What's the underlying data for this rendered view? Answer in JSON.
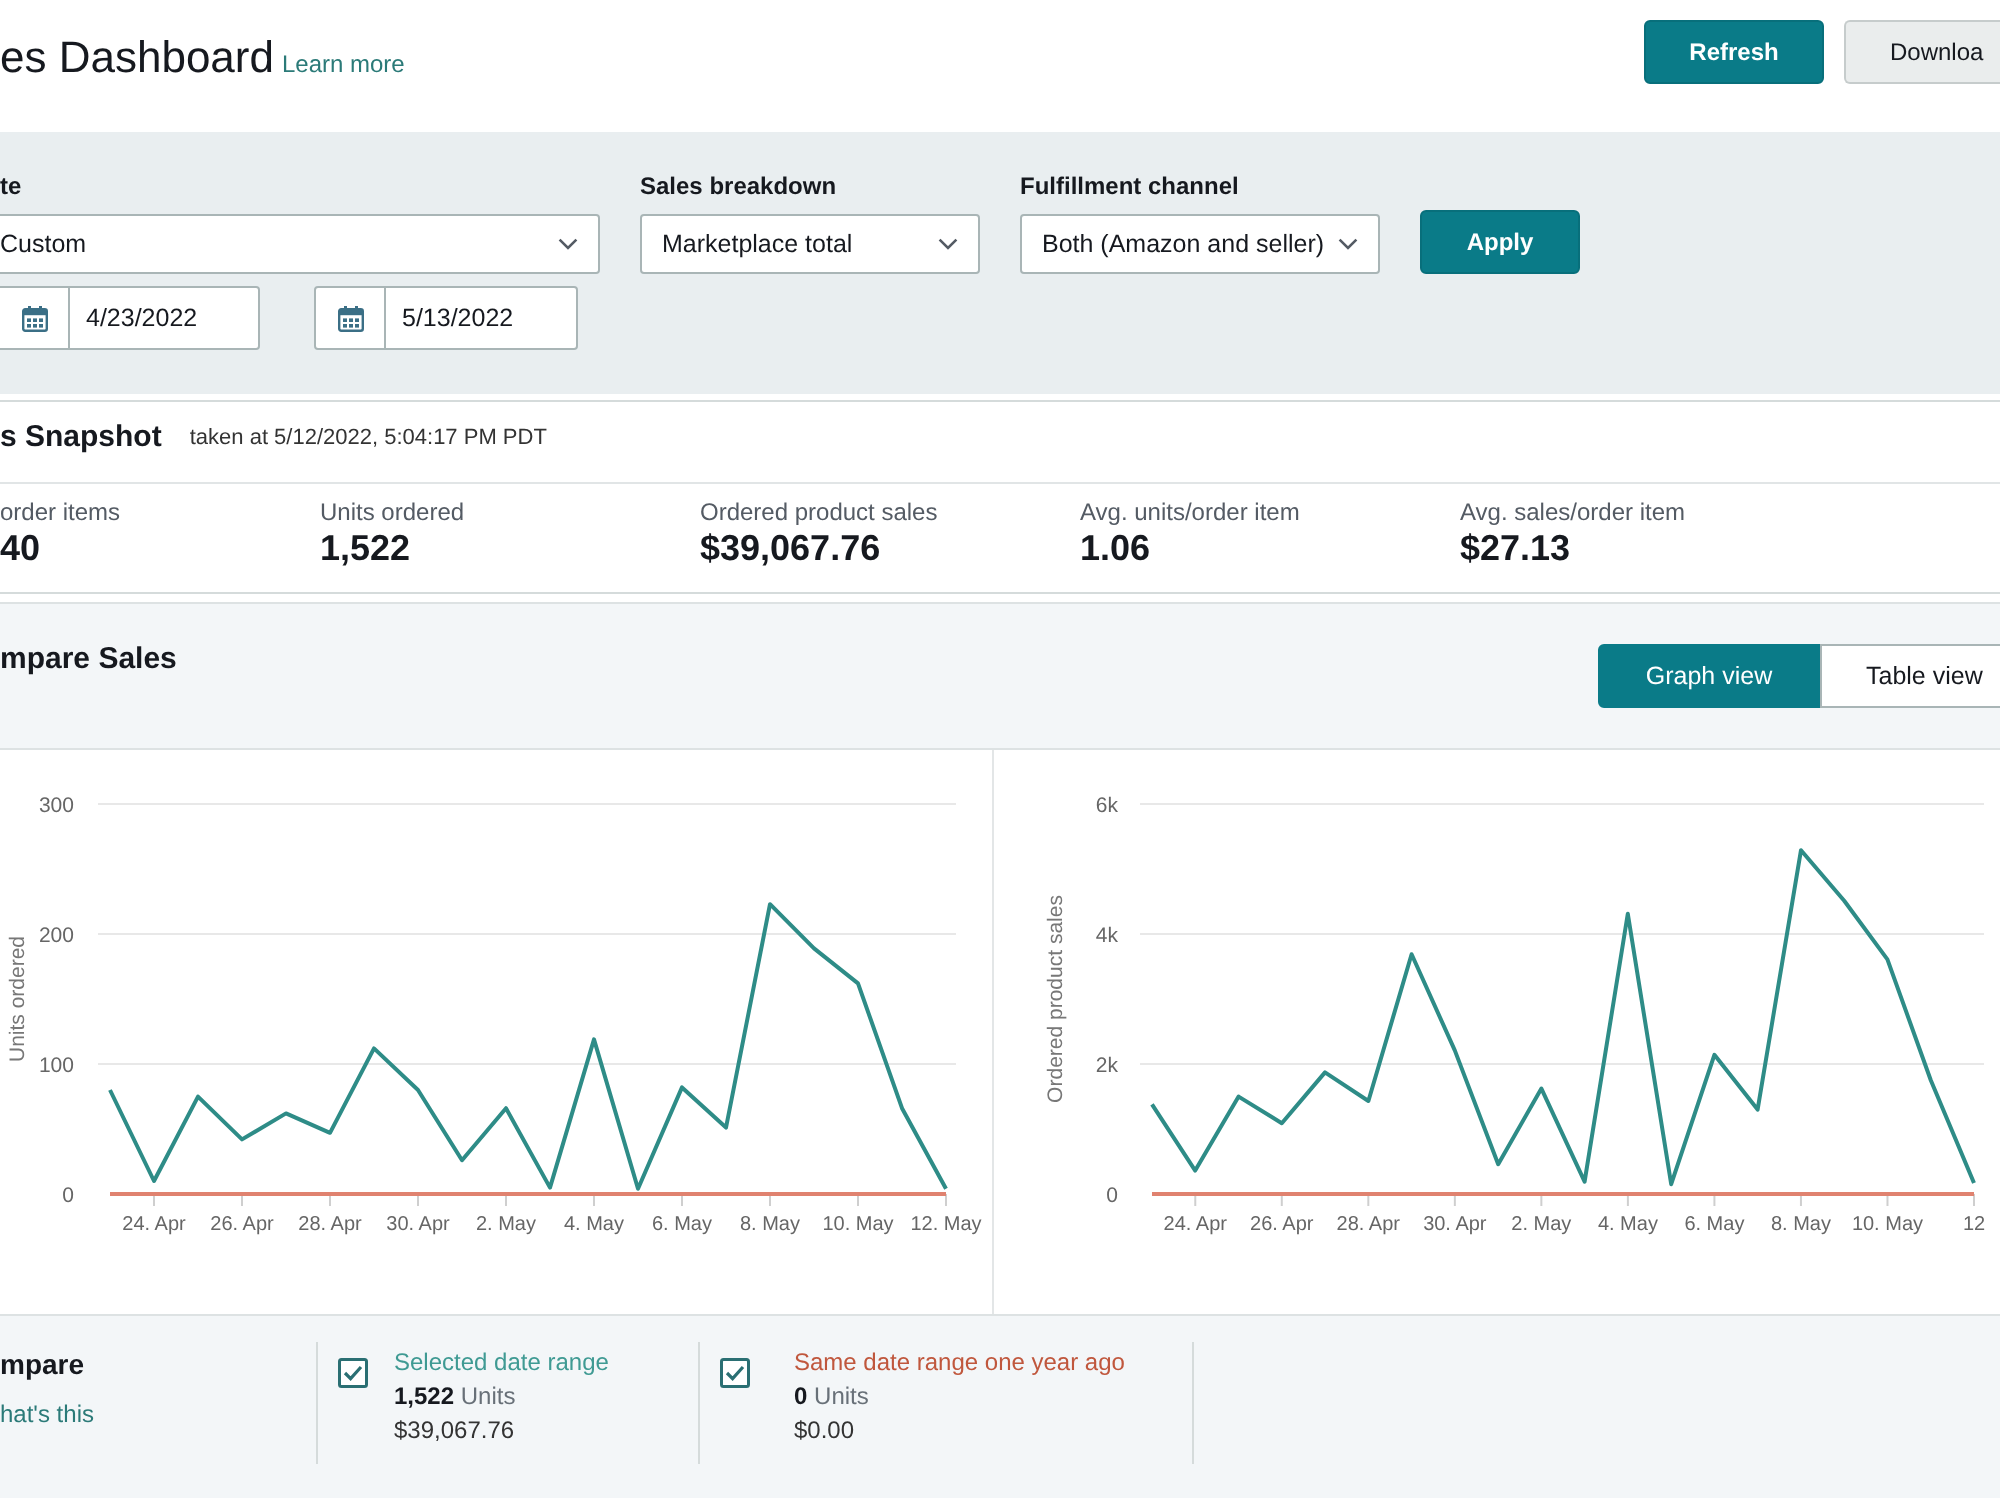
{
  "header": {
    "title": "es Dashboard",
    "learn_more": "Learn more",
    "refresh_button": "Refresh",
    "download_button": "Downloa"
  },
  "filters": {
    "date_range": {
      "label": "te",
      "value": "Custom",
      "start_date": "4/23/2022",
      "end_date": "5/13/2022"
    },
    "sales_breakdown": {
      "label": "Sales breakdown",
      "value": "Marketplace total"
    },
    "fulfillment_channel": {
      "label": "Fulfillment channel",
      "value": "Both (Amazon and seller)"
    },
    "apply_button": "Apply"
  },
  "snapshot": {
    "title": "s Snapshot",
    "taken_at": "taken at 5/12/2022, 5:04:17 PM PDT",
    "metrics": [
      {
        "label": "order items",
        "value": "40"
      },
      {
        "label": "Units ordered",
        "value": "1,522"
      },
      {
        "label": "Ordered product sales",
        "value": "$39,067.76"
      },
      {
        "label": "Avg. units/order item",
        "value": "1.06"
      },
      {
        "label": "Avg. sales/order item",
        "value": "$27.13"
      }
    ]
  },
  "compare_sales": {
    "title": "mpare Sales",
    "views": [
      {
        "label": "Graph view",
        "selected": true
      },
      {
        "label": "Table view",
        "selected": false
      }
    ],
    "charts": [
      {
        "chart_data": {
          "type": "line",
          "ylabel": "Units ordered",
          "categories": [
            null,
            "24. Apr",
            null,
            "26. Apr",
            null,
            "28. Apr",
            null,
            "30. Apr",
            null,
            "2. May",
            null,
            "4. May",
            null,
            "6. May",
            null,
            "8. May",
            null,
            "10. May",
            null,
            "12. May"
          ],
          "series": [
            {
              "color": "#2e8c87",
              "values": [
                80,
                10,
                75,
                42,
                62,
                47,
                112,
                80,
                26,
                66,
                5,
                119,
                4,
                82,
                51,
                223,
                189,
                162,
                66,
                4
              ]
            },
            {
              "color": "#e0826f",
              "values": [
                0,
                0,
                0,
                0,
                0,
                0,
                0,
                0,
                0,
                0,
                0,
                0,
                0,
                0,
                0,
                0,
                0,
                0,
                0,
                0
              ]
            }
          ],
          "ylim": [
            0,
            300
          ],
          "yticks": [
            0,
            100,
            200,
            300
          ]
        }
      },
      {
        "chart_data": {
          "type": "line",
          "ylabel": "Ordered product sales",
          "categories": [
            null,
            "24. Apr",
            null,
            "26. Apr",
            null,
            "28. Apr",
            null,
            "30. Apr",
            null,
            "2. May",
            null,
            "4. May",
            null,
            "6. May",
            null,
            "8. May",
            null,
            "10. May",
            null,
            "12"
          ],
          "series": [
            {
              "color": "#2e8c87",
              "values": [
                1380,
                360,
                1500,
                1090,
                1870,
                1430,
                3690,
                2210,
                460,
                1620,
                190,
                4310,
                150,
                2140,
                1300,
                5290,
                4510,
                3610,
                1750,
                170
              ]
            },
            {
              "color": "#e0826f",
              "values": [
                0,
                0,
                0,
                0,
                0,
                0,
                0,
                0,
                0,
                0,
                0,
                0,
                0,
                0,
                0,
                0,
                0,
                0,
                0,
                0
              ]
            }
          ],
          "ylim": [
            0,
            6000
          ],
          "yticks": [
            {
              "value": 0,
              "label": "0"
            },
            {
              "value": 2000,
              "label": "2k"
            },
            {
              "value": 4000,
              "label": "4k"
            },
            {
              "value": 6000,
              "label": "6k"
            }
          ]
        }
      }
    ],
    "legend": {
      "title": "mpare",
      "help_link": "hat's this",
      "series": [
        {
          "name": "Selected date range",
          "checked": true,
          "color": "#3f9a93",
          "units": "**1,522** Units",
          "sales": "$39,067.76"
        },
        {
          "name": "Same date range one year ago",
          "checked": true,
          "color": "#c0573d",
          "units": "**0** Units",
          "sales": "$0.00"
        }
      ]
    }
  }
}
